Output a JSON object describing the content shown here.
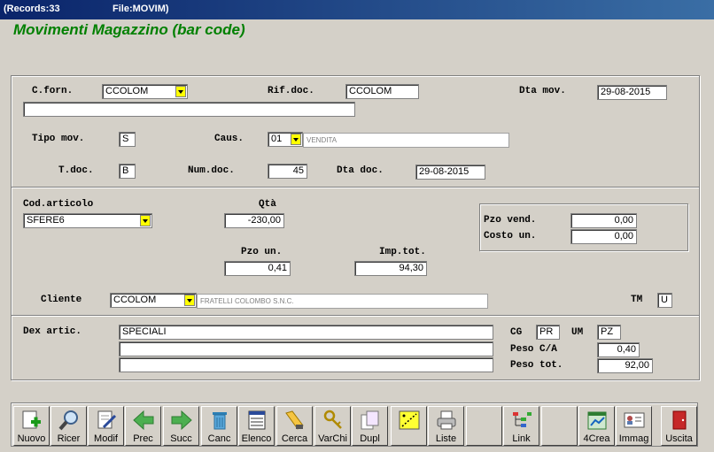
{
  "window": {
    "records_label": "(Records:33",
    "file_label": "File:MOVIM)"
  },
  "app_title": "Movimenti Magazzino (bar code)",
  "form": {
    "cforn_label": "C.forn.",
    "cforn_value": "CCOLOM",
    "cforn_desc": "",
    "rifdoc_label": "Rif.doc.",
    "rifdoc_value": "CCOLOM",
    "dtamov_label": "Dta mov.",
    "dtamov_value": "29-08-2015",
    "tipomov_label": "Tipo mov.",
    "tipomov_value": "S",
    "caus_label": "Caus.",
    "caus_value": "01",
    "caus_desc": "VENDITA",
    "tdoc_label": "T.doc.",
    "tdoc_value": "B",
    "numdoc_label": "Num.doc.",
    "numdoc_value": "45",
    "dtadoc_label": "Dta doc.",
    "dtadoc_value": "29-08-2015",
    "codart_label": "Cod.articolo",
    "codart_value": "SFERE6",
    "qta_label": "Qtà",
    "qta_value": "-230,00",
    "pzovend_label": "Pzo vend.",
    "pzovend_value": "0,00",
    "costoun_label": "Costo un.",
    "costoun_value": "0,00",
    "pzoun_label": "Pzo un.",
    "pzoun_value": "0,41",
    "imptot_label": "Imp.tot.",
    "imptot_value": "94,30",
    "cliente_label": "Cliente",
    "cliente_value": "CCOLOM",
    "cliente_desc": "FRATELLI COLOMBO S.N.C.",
    "tm_label": "TM",
    "tm_value": "U",
    "dexartic_label": "Dex artic.",
    "dexartic_line1": "SPECIALI",
    "dexartic_line2": "",
    "dexartic_line3": "",
    "cg_label": "CG",
    "cg_value": "PR",
    "um_label": "UM",
    "um_value": "PZ",
    "pesoca_label": "Peso C/A",
    "pesoca_value": "0,40",
    "pesotot_label": "Peso tot.",
    "pesotot_value": "92,00"
  },
  "toolbar": {
    "nuovo": "Nuovo",
    "ricer": "Ricer",
    "modif": "Modif",
    "prec": "Prec",
    "succ": "Succ",
    "canc": "Canc",
    "elenco": "Elenco",
    "cerca": "Cerca",
    "varchi": "VarChi",
    "dupl": "Dupl",
    "liste": "Liste",
    "link": "Link",
    "crea4": "4Crea",
    "immag": "Immag",
    "uscita": "Uscita"
  },
  "colors": {
    "title_green": "#008000",
    "titlebar_blue": "#0a246a",
    "dropdown_yellow": "#ffff00"
  }
}
